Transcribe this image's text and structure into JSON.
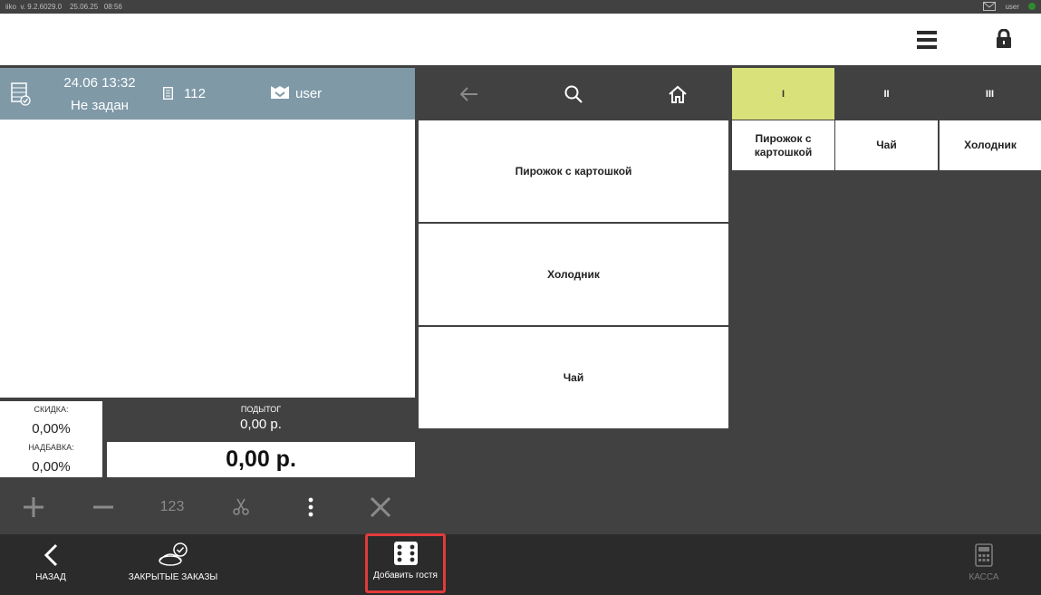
{
  "status_bar": {
    "version": "iiko  v. 9.2.6029.0",
    "date": "25.06.25",
    "time": "08:56",
    "user": "user"
  },
  "order": {
    "datetime": "24.06 13:32",
    "table": "Не задан",
    "order_number": "112",
    "waiter": "user"
  },
  "totals": {
    "discount_label": "СКИДКА:",
    "discount_value": "0,00%",
    "surcharge_label": "НАДБАВКА:",
    "surcharge_value": "0,00%",
    "subtotal_label": "ПОДЫТОГ",
    "subtotal_value": "0,00 р.",
    "total_value": "0,00 р."
  },
  "toolbar": {
    "quantity_label": "123"
  },
  "tabs": [
    "I",
    "II",
    "III"
  ],
  "categories": [
    "Пирожок с картошкой",
    "Холодник",
    "Чай"
  ],
  "quick_products": [
    "Пирожок с картошкой",
    "Чай",
    "Холодник"
  ],
  "bottom": {
    "back_label": "НАЗАД",
    "closed_orders_label": "ЗАКРЫТЫЕ ЗАКАЗЫ",
    "add_guest_label": "Добавить гостя",
    "cash_label": "КАССА"
  },
  "colors": {
    "order_header": "#7f99a7",
    "active_tab": "#d9e27a",
    "dark": "#414141",
    "highlight_border": "#e23a3a"
  }
}
